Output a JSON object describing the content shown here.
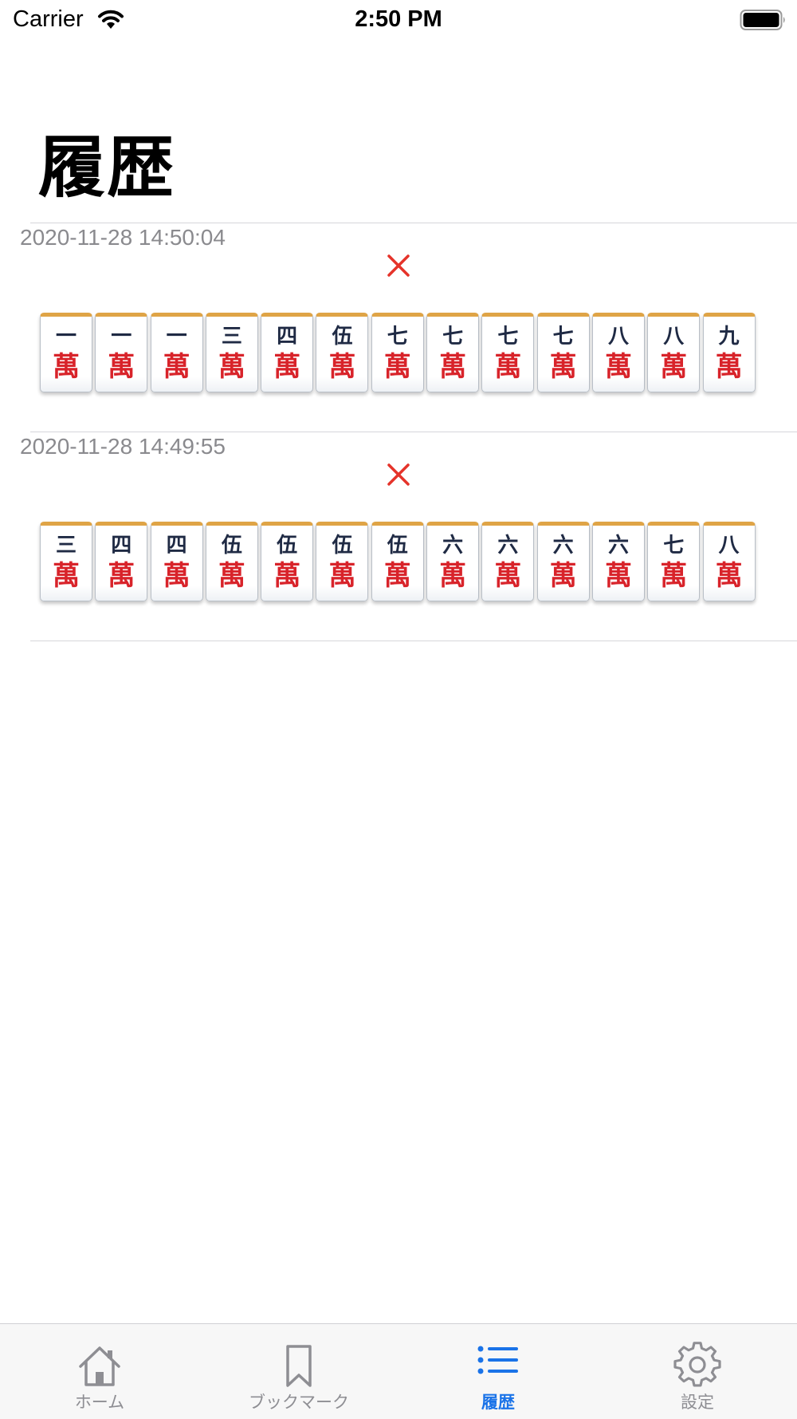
{
  "status_bar": {
    "carrier": "Carrier",
    "time": "2:50 PM"
  },
  "page": {
    "title": "履歴"
  },
  "history": [
    {
      "timestamp": "2020-11-28 14:50:04",
      "result": "incorrect",
      "tiles": [
        {
          "number": "一",
          "suit": "萬"
        },
        {
          "number": "一",
          "suit": "萬"
        },
        {
          "number": "一",
          "suit": "萬"
        },
        {
          "number": "三",
          "suit": "萬"
        },
        {
          "number": "四",
          "suit": "萬"
        },
        {
          "number": "伍",
          "suit": "萬"
        },
        {
          "number": "七",
          "suit": "萬"
        },
        {
          "number": "七",
          "suit": "萬"
        },
        {
          "number": "七",
          "suit": "萬"
        },
        {
          "number": "七",
          "suit": "萬"
        },
        {
          "number": "八",
          "suit": "萬"
        },
        {
          "number": "八",
          "suit": "萬"
        },
        {
          "number": "九",
          "suit": "萬"
        }
      ]
    },
    {
      "timestamp": "2020-11-28 14:49:55",
      "result": "incorrect",
      "tiles": [
        {
          "number": "三",
          "suit": "萬"
        },
        {
          "number": "四",
          "suit": "萬"
        },
        {
          "number": "四",
          "suit": "萬"
        },
        {
          "number": "伍",
          "suit": "萬"
        },
        {
          "number": "伍",
          "suit": "萬"
        },
        {
          "number": "伍",
          "suit": "萬"
        },
        {
          "number": "伍",
          "suit": "萬"
        },
        {
          "number": "六",
          "suit": "萬"
        },
        {
          "number": "六",
          "suit": "萬"
        },
        {
          "number": "六",
          "suit": "萬"
        },
        {
          "number": "六",
          "suit": "萬"
        },
        {
          "number": "七",
          "suit": "萬"
        },
        {
          "number": "八",
          "suit": "萬"
        }
      ]
    }
  ],
  "tab_bar": {
    "tabs": [
      {
        "label": "ホーム",
        "icon": "home-icon",
        "active": false
      },
      {
        "label": "ブックマーク",
        "icon": "bookmark-icon",
        "active": false
      },
      {
        "label": "履歴",
        "icon": "list-icon",
        "active": true
      },
      {
        "label": "設定",
        "icon": "gear-icon",
        "active": false
      }
    ]
  },
  "colors": {
    "accent": "#1a73e8",
    "incorrect_mark": "#e5332a",
    "tile_number": "#1f2a44",
    "tile_suit": "#d8232a",
    "timestamp": "#8a8a8e",
    "tab_inactive": "#8e8e93"
  }
}
